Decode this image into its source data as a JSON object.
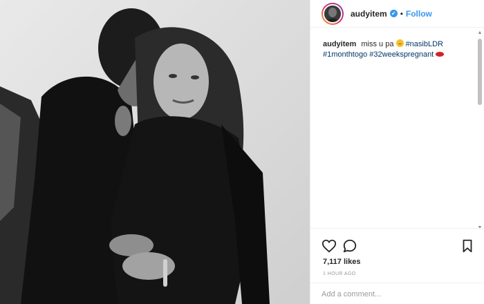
{
  "post": {
    "username": "audyitem",
    "verified_icon": "✔",
    "separator": "•",
    "follow_label": "Follow",
    "caption": {
      "username": "audyitem",
      "text": "miss u pa",
      "emoji_sad": "disappointed-face-emoji",
      "tags": [
        "#nasibLDR",
        "#1monthtogo",
        "#32weekspregnant"
      ],
      "emoji_lips": "kiss-mark-emoji"
    },
    "likes": "7,117 likes",
    "time": "1 HOUR AGO",
    "comment_placeholder": "Add a comment..."
  },
  "icons": {
    "like": "heart-icon",
    "comment": "comment-icon",
    "save": "bookmark-icon",
    "verified": "verified-badge-icon"
  },
  "colors": {
    "link": "#3897f0",
    "hashtag": "#003569",
    "text": "#262626",
    "muted": "#999999"
  }
}
